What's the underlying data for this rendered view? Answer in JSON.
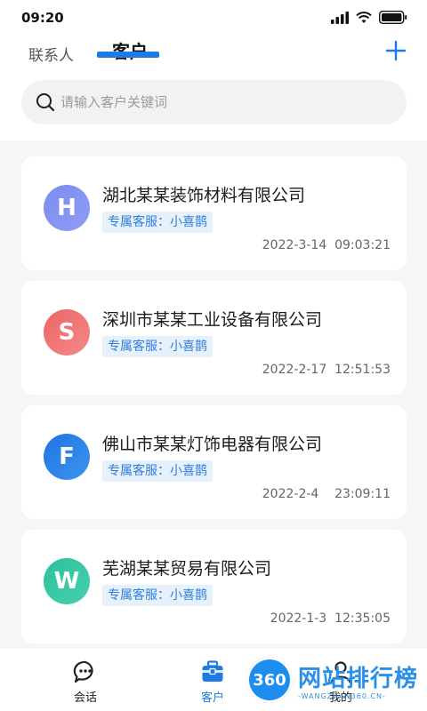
{
  "status_bar": {
    "time": "09:20"
  },
  "tabs": [
    {
      "label": "联系人",
      "active": false
    },
    {
      "label": "客户",
      "active": true
    }
  ],
  "search": {
    "placeholder": "请输入客户关键词",
    "value": ""
  },
  "customers": [
    {
      "initial": "H",
      "name": "湖北某某装饰材料有限公司",
      "service": "专属客服：小喜鹊",
      "time": "2022-3-14  09:03:21",
      "avatar_color": "#7f8ff0"
    },
    {
      "initial": "S",
      "name": "深圳市某某工业设备有限公司",
      "service": "专属客服：小喜鹊",
      "time": "2022-2-17  12:51:53",
      "avatar_color": "#ef6f6f"
    },
    {
      "initial": "F",
      "name": "佛山市某某灯饰电器有限公司",
      "service": "专属客服：小喜鹊",
      "time": "2022-2-4    23:09:11",
      "avatar_color": "#2f83e6"
    },
    {
      "initial": "W",
      "name": "芜湖某某贸易有限公司",
      "service": "专属客服：小喜鹊",
      "time": "2022-1-3  12:35:05",
      "avatar_color": "#33c6a4"
    }
  ],
  "bottom_nav": [
    {
      "label": "会话",
      "icon": "chat-icon"
    },
    {
      "label": "客户",
      "icon": "briefcase-icon",
      "active": true
    },
    {
      "label": "我的",
      "icon": "user-icon"
    }
  ],
  "watermark": {
    "badge": "360",
    "text": "网站排行榜",
    "url": "-WANGZHAN360.CN-"
  },
  "colors": {
    "accent": "#1e7be6",
    "tag_bg": "#e6f1fc",
    "tag_text": "#2f7fd9"
  }
}
